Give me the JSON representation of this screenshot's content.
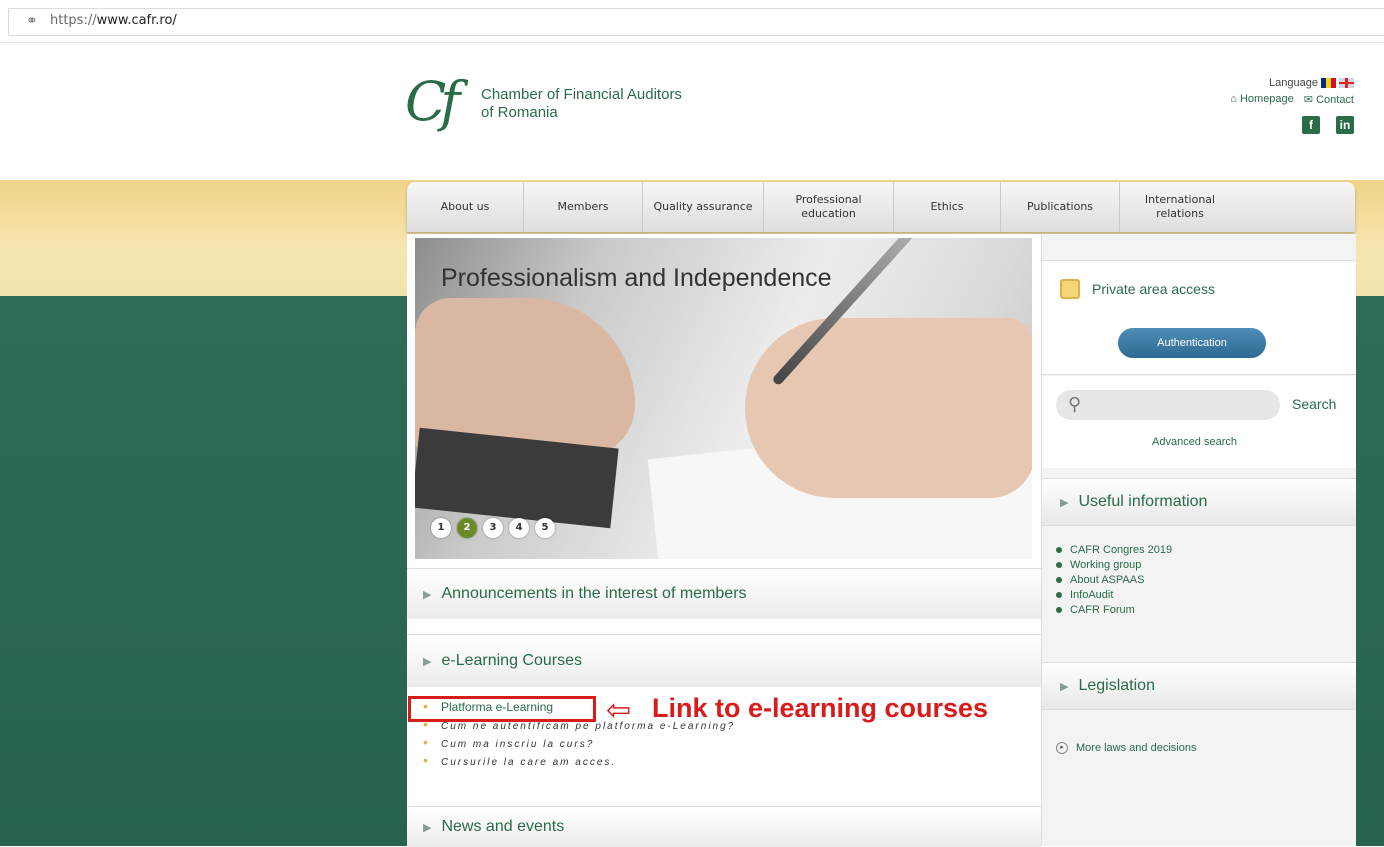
{
  "browser": {
    "url_prefix": "https://",
    "url_host": "www.cafr.ro/"
  },
  "header": {
    "logo_mark": "Cf",
    "org_name_line1": "Chamber of Financial Auditors",
    "org_name_line2": "of Romania",
    "language_label": "Language",
    "homepage": "Homepage",
    "contact": "Contact",
    "social": [
      "f",
      "in"
    ]
  },
  "nav": {
    "items": [
      {
        "label": "About us"
      },
      {
        "label": "Members"
      },
      {
        "label": "Quality assurance"
      },
      {
        "label": "Professional education"
      },
      {
        "label": "Ethics"
      },
      {
        "label": "Publications"
      },
      {
        "label": "International relations"
      }
    ]
  },
  "hero": {
    "title": "Professionalism and Independence",
    "slides": [
      "1",
      "2",
      "3",
      "4",
      "5"
    ],
    "active_slide": "2"
  },
  "sections": {
    "announcements": "Announcements in the interest of members",
    "elearning": "e-Learning Courses",
    "news": "News and events"
  },
  "elearning_list": {
    "platform_link": "Platforma e-Learning",
    "items": [
      "Cum ne autentificam pe platforma e-Learning?",
      "Cum ma inscriu la curs?",
      "Cursurile la care am acces."
    ]
  },
  "callout": {
    "text": "Link to e-learning courses",
    "color": "#d81c1c"
  },
  "sidebar": {
    "private_area": "Private area access",
    "auth_button": "Authentication",
    "search_button": "Search",
    "advanced_search": "Advanced search",
    "useful_info": "Useful information",
    "useful_links": [
      "CAFR Congres 2019",
      "Working group",
      "About ASPAAS",
      "InfoAudit",
      "CAFR Forum"
    ],
    "legislation": "Legislation",
    "more_laws": "More laws and decisions"
  },
  "colors": {
    "brand_green": "#2a6b48",
    "accent_yellow": "#f0d488",
    "auth_blue": "#2d6a93"
  }
}
